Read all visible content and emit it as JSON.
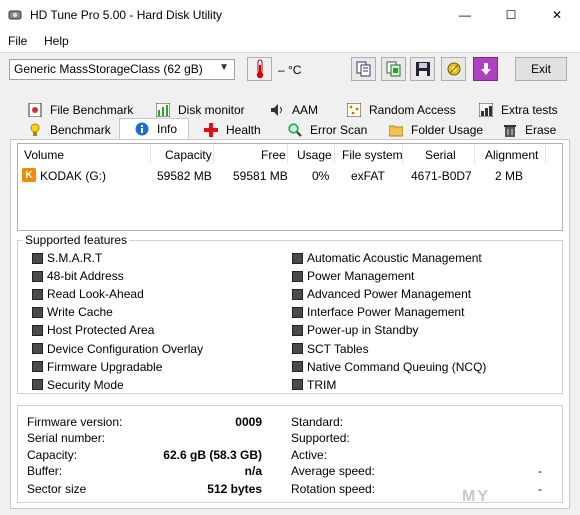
{
  "window": {
    "title": "HD Tune Pro 5.00 - Hard Disk Utility",
    "minimize": "—",
    "maximize": "☐",
    "close": "✕"
  },
  "menu": {
    "file": "File",
    "help": "Help"
  },
  "toolbar": {
    "drive": "Generic MassStorageClass (62 gB)",
    "temperature": "– °C",
    "exit_label": "Exit"
  },
  "tabs_top": [
    {
      "label": "File Benchmark"
    },
    {
      "label": "Disk monitor"
    },
    {
      "label": "AAM"
    },
    {
      "label": "Random Access"
    },
    {
      "label": "Extra tests"
    }
  ],
  "tabs_bottom": [
    {
      "label": "Benchmark"
    },
    {
      "label": "Info"
    },
    {
      "label": "Health"
    },
    {
      "label": "Error Scan"
    },
    {
      "label": "Folder Usage"
    },
    {
      "label": "Erase"
    }
  ],
  "volume_table": {
    "headers": [
      "Volume",
      "Capacity",
      "Free",
      "Usage",
      "File system",
      "Serial",
      "Alignment"
    ],
    "rows": [
      {
        "volume": "KODAK (G:)",
        "capacity": "59582 MB",
        "free": "59581 MB",
        "usage": "0%",
        "fs": "exFAT",
        "serial": "4671-B0D7",
        "alignment": "2 MB"
      }
    ]
  },
  "features": {
    "title": "Supported features",
    "left": [
      "S.M.A.R.T",
      "48-bit Address",
      "Read Look-Ahead",
      "Write Cache",
      "Host Protected Area",
      "Device Configuration Overlay",
      "Firmware Upgradable",
      "Security Mode"
    ],
    "right": [
      "Automatic Acoustic Management",
      "Power Management",
      "Advanced Power Management",
      "Interface Power Management",
      "Power-up in Standby",
      "SCT Tables",
      "Native Command Queuing (NCQ)",
      "TRIM"
    ]
  },
  "info": {
    "left": [
      {
        "label": "Firmware version:",
        "value": "0009"
      },
      {
        "label": "Serial number:",
        "value": ""
      },
      {
        "label": "Capacity:",
        "value": "62.6 gB (58.3 GB)"
      },
      {
        "label": "Buffer:",
        "value": "n/a"
      },
      {
        "label": "Sector size",
        "value": "512 bytes"
      }
    ],
    "right": [
      {
        "label": "Standard:",
        "value": ""
      },
      {
        "label": "Supported:",
        "value": ""
      },
      {
        "label": "Active:",
        "value": ""
      },
      {
        "label": "Average speed:",
        "value": "-"
      },
      {
        "label": "Rotation speed:",
        "value": "-"
      }
    ]
  },
  "watermark": "MY"
}
